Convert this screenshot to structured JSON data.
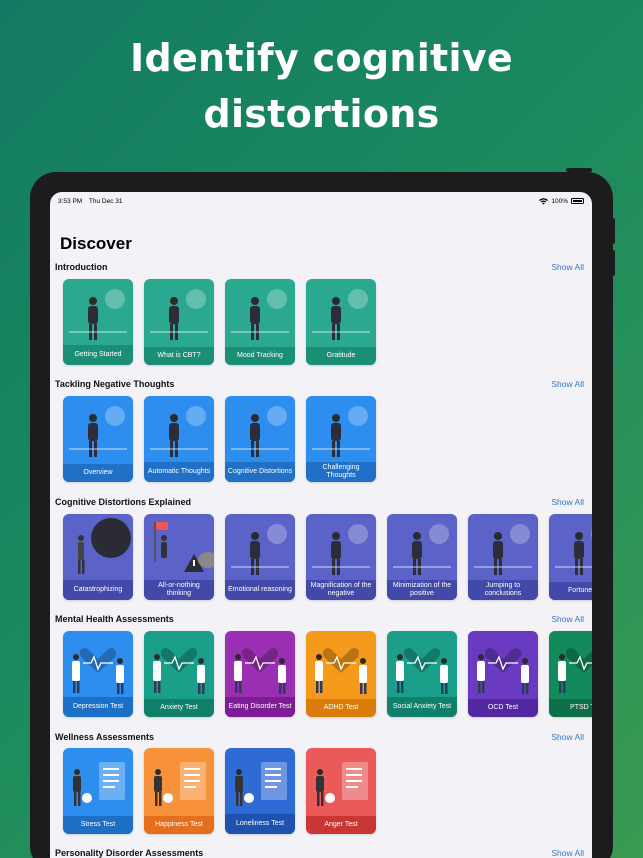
{
  "headline": {
    "line1": "Identify cognitive",
    "line2": "distortions"
  },
  "status_bar": {
    "time": "3:53 PM",
    "date": "Thu Dec 31",
    "battery": "100%"
  },
  "page_title": "Discover",
  "sections": [
    {
      "title": "Introduction",
      "show_all": "Show All",
      "cards": [
        {
          "label": "Getting Started",
          "color": "#2aa890",
          "band": "#1a8f76",
          "icon": "people-jumping-illustration"
        },
        {
          "label": "What is CBT?",
          "color": "#2aa890",
          "band": "#1a8f76",
          "icon": "person-holding-globe-illustration"
        },
        {
          "label": "Mood Tracking",
          "color": "#2aa890",
          "band": "#1a8f76",
          "icon": "person-at-board-illustration"
        },
        {
          "label": "Gratitude",
          "color": "#2aa890",
          "band": "#1a8f76",
          "icon": "person-with-hearts-illustration"
        }
      ]
    },
    {
      "title": "Tackling Negative Thoughts",
      "show_all": "Show All",
      "cards": [
        {
          "label": "Overview",
          "color": "#2d8ef0",
          "band": "#2170c8",
          "icon": "path-illustration"
        },
        {
          "label": "Automatic Thoughts",
          "color": "#2d8ef0",
          "band": "#2170c8",
          "icon": "person-thinking-illustration"
        },
        {
          "label": "Cognitive Distortions",
          "color": "#2d8ef0",
          "band": "#2170c8",
          "icon": "person-at-screen-illustration"
        },
        {
          "label": "Challenging Thoughts",
          "color": "#2d8ef0",
          "band": "#2170c8",
          "icon": "person-with-tiles-illustration"
        }
      ]
    },
    {
      "title": "Cognitive Distortions Explained",
      "show_all": "Show All",
      "cards": [
        {
          "label": "Catastrophizing",
          "color": "#5b62c8",
          "band": "#4349a8",
          "icon": "dark-cloud-illustration"
        },
        {
          "label": "All-or-nothing thinking",
          "color": "#5b62c8",
          "band": "#4349a8",
          "icon": "warning-sign-illustration"
        },
        {
          "label": "Emotional reasoning",
          "color": "#5b62c8",
          "band": "#4349a8",
          "icon": "person-thinking-illustration"
        },
        {
          "label": "Magnification of the negative",
          "color": "#5b62c8",
          "band": "#4349a8",
          "icon": "person-with-block-illustration"
        },
        {
          "label": "Minimization of the positive",
          "color": "#5b62c8",
          "band": "#4349a8",
          "icon": "person-running-illustration"
        },
        {
          "label": "Jumping to conclusions",
          "color": "#5b62c8",
          "band": "#4349a8",
          "icon": "hurdle-jump-illustration"
        },
        {
          "label": "Fortune te",
          "color": "#5b62c8",
          "band": "#4349a8",
          "icon": "crystal-ball-illustration"
        }
      ]
    },
    {
      "title": "Mental Health Assessments",
      "show_all": "Show All",
      "cards": [
        {
          "label": "Depression Test",
          "color": "#2d8ef0",
          "band": "#1d6fc6",
          "icon": "doctors-heart-illustration"
        },
        {
          "label": "Anxiety Test",
          "color": "#1aa08a",
          "band": "#10806c",
          "icon": "doctors-heart-illustration"
        },
        {
          "label": "Eating Disorder Test",
          "color": "#9b2fb3",
          "band": "#7d1d93",
          "icon": "doctors-heart-illustration"
        },
        {
          "label": "ADHD Test",
          "color": "#f59a1a",
          "band": "#d97c0a",
          "icon": "doctors-heart-illustration"
        },
        {
          "label": "Social Anxiety Test",
          "color": "#1aa08a",
          "band": "#10806c",
          "icon": "doctors-heart-illustration"
        },
        {
          "label": "OCD Test",
          "color": "#6a3bc0",
          "band": "#5128a0",
          "icon": "doctors-heart-illustration"
        },
        {
          "label": "PTSD Te",
          "color": "#138a5c",
          "band": "#0d6e48",
          "icon": "doctors-heart-illustration"
        }
      ]
    },
    {
      "title": "Wellness Assessments",
      "show_all": "Show All",
      "cards": [
        {
          "label": "Stress Test",
          "color": "#2d8ef0",
          "band": "#1d6fc6",
          "icon": "person-with-checklist-illustration"
        },
        {
          "label": "Happiness Test",
          "color": "#f7913a",
          "band": "#e56f1c",
          "icon": "person-with-checklist-illustration"
        },
        {
          "label": "Loneliness Test",
          "color": "#2f6bd4",
          "band": "#1f52b0",
          "icon": "person-with-checklist-illustration"
        },
        {
          "label": "Anger Test",
          "color": "#ea5a5a",
          "band": "#c93636",
          "icon": "person-with-checklist-illustration"
        }
      ]
    },
    {
      "title": "Personality Disorder Assessments",
      "show_all": "Show All",
      "cards": []
    }
  ]
}
